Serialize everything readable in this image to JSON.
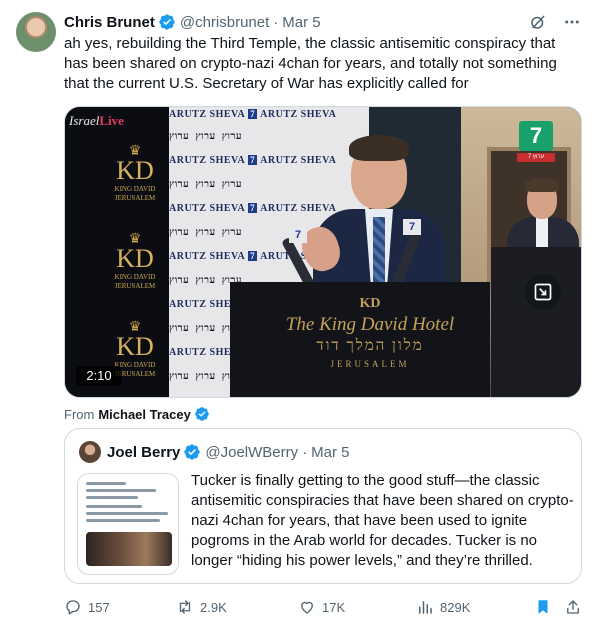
{
  "tweet": {
    "author_name": "Chris Brunet",
    "author_handle": "@chrisbrunet",
    "separator": "·",
    "date": "Mar 5",
    "text": "ah yes, rebuilding the Third Temple, the classic antisemitic conspiracy that\nhas been shared on crypto-nazi 4chan for years, and totally not something\nthat the current U.S. Secretary of War has explicitly called for"
  },
  "video": {
    "duration": "2:10",
    "overlay_logo": "Israel",
    "overlay_logo_accent": "Live",
    "channel_badge": "7",
    "channel_badge_sub": "ערוץ 7",
    "press_wall_text": "ARUTZ SHEVA",
    "press_wall_logo": "7",
    "press_wall_hebrew": "ערוץ",
    "kd_mark": "KD",
    "kd_sub": "KING DAVID",
    "kd_city": "JERUSALEM",
    "podium_kd": "KD",
    "podium_name": "The King David Hotel",
    "podium_hebrew": "מלון המלך דוד",
    "podium_city": "JERUSALEM"
  },
  "from_label": "From",
  "from_user": "Michael Tracey",
  "quote": {
    "author_name": "Joel Berry",
    "author_handle": "@JoelWBerry",
    "separator": "·",
    "date": "Mar 5",
    "text": "Tucker is finally getting to the good stuff—the classic antisemitic conspiracies that have been shared on crypto-nazi 4chan for years, that have been used to ignite pogroms in the Arab world for decades. Tucker is no longer “hiding his power levels,” and they’re thrilled."
  },
  "actions": {
    "replies": "157",
    "reposts": "2.9K",
    "likes": "17K",
    "views": "829K"
  },
  "colors": {
    "verified": "#1d9bf0",
    "text": "#0f1419",
    "secondary": "#536471",
    "bookmark_active": "#1d9bf0"
  },
  "icons": [
    "verified-badge-icon",
    "grok-icon",
    "more-icon",
    "expand-icon",
    "reply-icon",
    "repost-icon",
    "like-icon",
    "views-icon",
    "bookmark-icon",
    "share-icon"
  ]
}
